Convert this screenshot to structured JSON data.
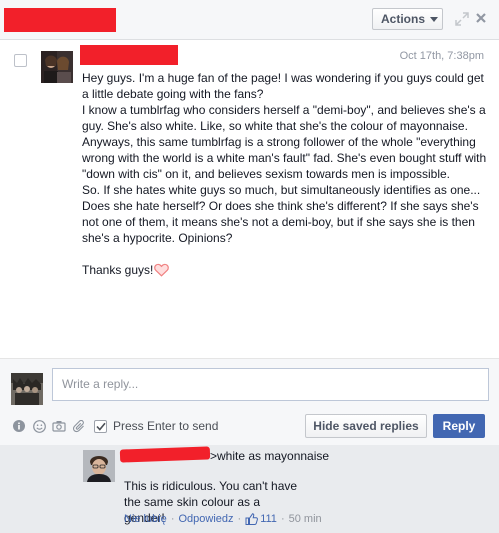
{
  "header": {
    "actions_label": "Actions"
  },
  "message": {
    "timestamp": "Oct 17th, 7:38pm",
    "paragraphs": [
      "Hey guys. I'm a huge fan of the page! I was wondering if you guys could get a little debate going with the fans?",
      "I know a tumblrfag who considers herself a \"demi-boy\", and believes she's a guy. She's also white. Like, so white that she's the colour of mayonnaise. Anyways, this same tumblrfag is a strong follower of the whole \"everything wrong with the world is a white man's fault\" fad. She's even bought stuff with \"down with cis\" on it, and believes sexism towards men is impossible.",
      "So. If she hates white guys so much, but simultaneously identifies as one... Does she hate herself? Or does she think she's different? If she says she's not one of them, it means she's not a demi-boy, but if she says she is then she's a hypocrite. Opinions?"
    ],
    "closing": "Thanks guys!"
  },
  "reply": {
    "placeholder": "Write a reply...",
    "press_enter_label": "Press Enter to send",
    "hide_saved_label": "Hide saved replies",
    "reply_label": "Reply"
  },
  "comment": {
    "quote": ">white as mayonnaise",
    "text": "This is ridiculous. You can't have the same skin colour as a gender!",
    "like_label": "Nie lubię",
    "reply_label": "Odpowiedz",
    "like_count": "111",
    "time": "50 min"
  },
  "colors": {
    "redaction": "#f2202a",
    "link": "#4267b2",
    "heart": "#f08080"
  },
  "icons": [
    "expand-icon",
    "close-icon",
    "info-icon",
    "emoji-icon",
    "camera-icon",
    "paperclip-icon",
    "heart-icon",
    "thumbs-up-icon"
  ]
}
